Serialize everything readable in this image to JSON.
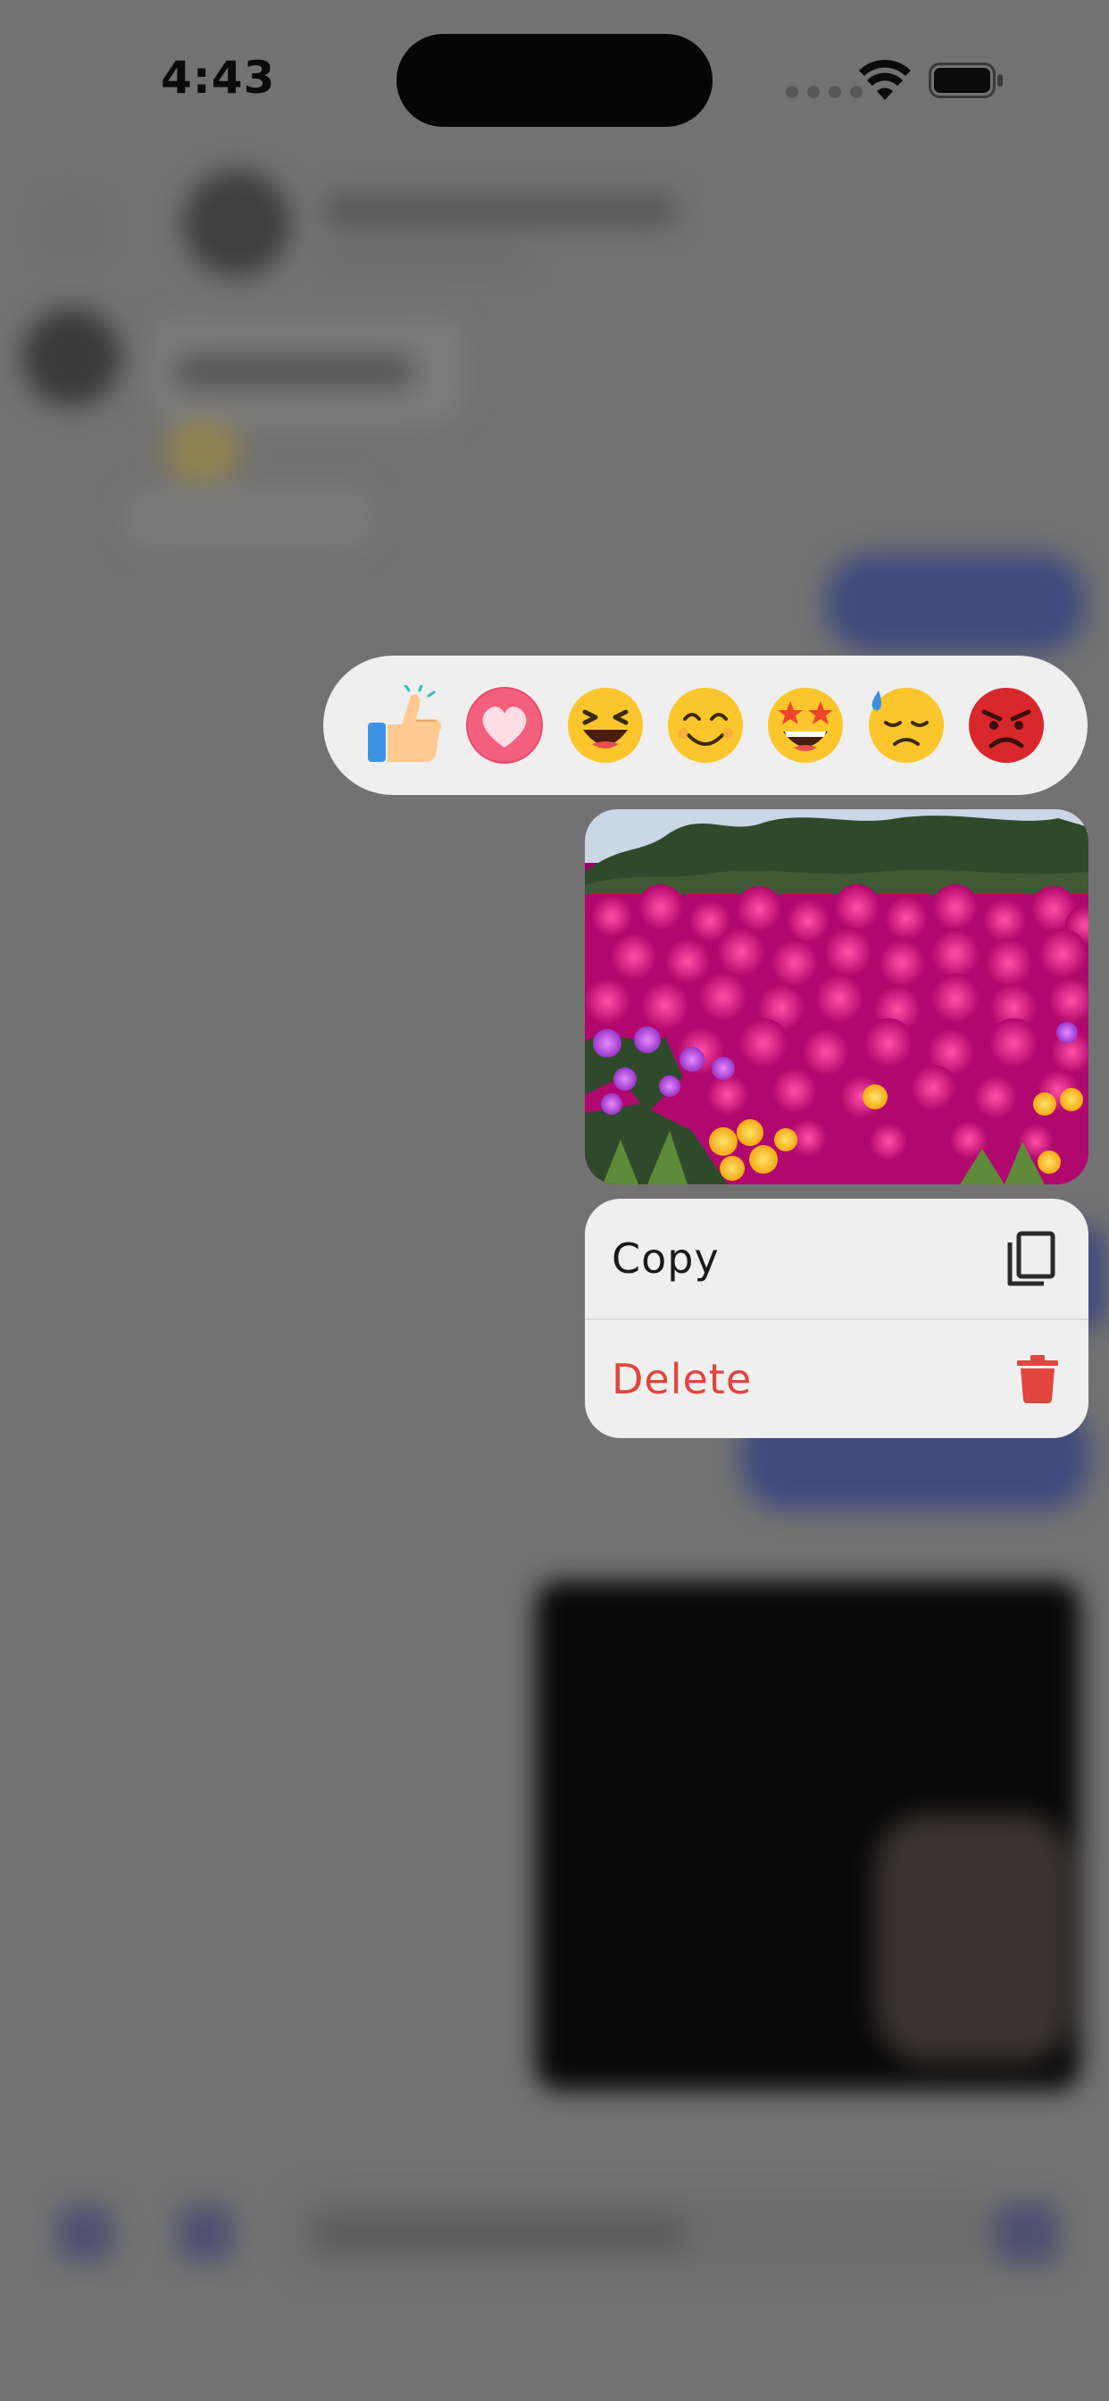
{
  "status_bar": {
    "time": "4:43"
  },
  "reactions": [
    {
      "name": "thumbs-up-emoji"
    },
    {
      "name": "heart-emoji"
    },
    {
      "name": "laughing-emoji"
    },
    {
      "name": "smiling-emoji"
    },
    {
      "name": "star-struck-emoji"
    },
    {
      "name": "sad-sweat-emoji"
    },
    {
      "name": "angry-emoji"
    }
  ],
  "context_menu": {
    "copy_label": "Copy",
    "delete_label": "Delete"
  },
  "colors": {
    "dim_overlay": "#727272",
    "menu_bg": "#efefef",
    "delete_red": "#e0453e"
  }
}
